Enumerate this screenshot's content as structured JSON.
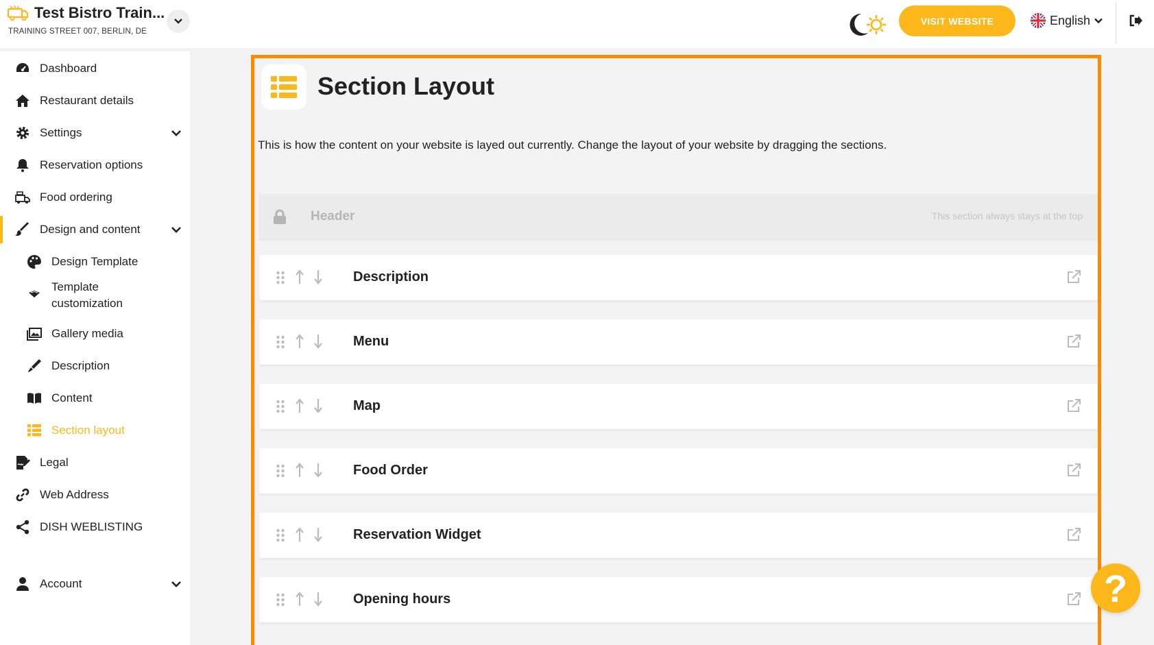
{
  "brand": {
    "title": "Test Bistro Train...",
    "address": "TRAINING STREET 007, BERLIN, DE"
  },
  "topbar": {
    "visit_label": "VISIT WEBSITE",
    "language": "English"
  },
  "sidebar": {
    "items": [
      {
        "label": "Dashboard",
        "icon": "dashboard-icon"
      },
      {
        "label": "Restaurant details",
        "icon": "home-icon"
      },
      {
        "label": "Settings",
        "icon": "gear-icon"
      },
      {
        "label": "Reservation options",
        "icon": "bell-icon"
      },
      {
        "label": "Food ordering",
        "icon": "food-ordering-icon"
      },
      {
        "label": "Design and content",
        "icon": "brush-icon"
      },
      {
        "label": "Design Template",
        "icon": "palette-icon"
      },
      {
        "label": "Template\ncustomization",
        "icon": "template-icon"
      },
      {
        "label": "Gallery media",
        "icon": "gallery-icon"
      },
      {
        "label": "Description",
        "icon": "pen-icon"
      },
      {
        "label": "Content",
        "icon": "book-icon"
      },
      {
        "label": "Section layout",
        "icon": "list-icon"
      },
      {
        "label": "Legal",
        "icon": "legal-icon"
      },
      {
        "label": "Web Address",
        "icon": "link-icon"
      },
      {
        "label": "DISH WEBLISTING",
        "icon": "share-icon"
      },
      {
        "label": "Account",
        "icon": "user-icon"
      }
    ]
  },
  "main": {
    "title": "Section Layout",
    "description": "This is how the content on your website is layed out currently. Change the layout of your website by dragging the sections.",
    "header_section": {
      "name": "Header",
      "note": "This section always stays at the top"
    },
    "sections": [
      {
        "name": "Description"
      },
      {
        "name": "Menu"
      },
      {
        "name": "Map"
      },
      {
        "name": "Food Order"
      },
      {
        "name": "Reservation Widget"
      },
      {
        "name": "Opening hours"
      }
    ]
  },
  "help": {
    "label": "?"
  },
  "colors": {
    "accent": "#fcb81b",
    "highlight": "#ff8a00"
  }
}
